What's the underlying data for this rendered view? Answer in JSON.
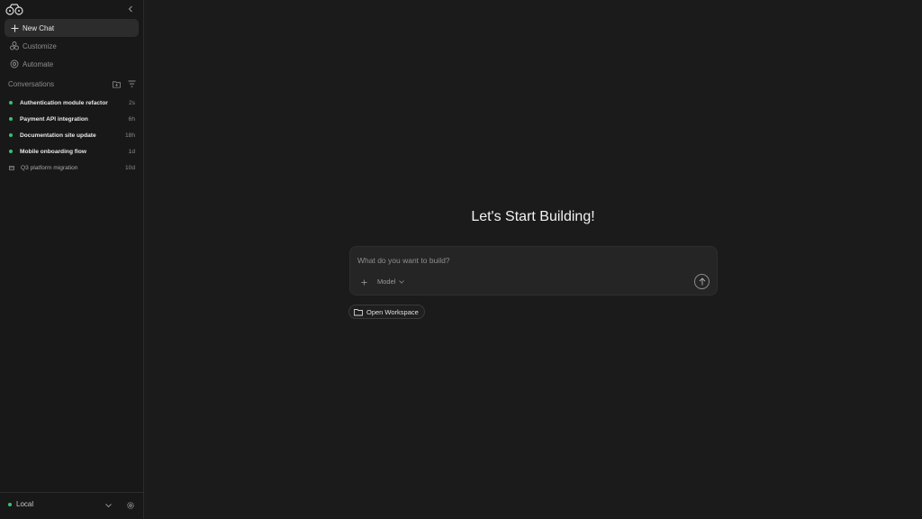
{
  "sidebar": {
    "nav": [
      {
        "label": "New Chat",
        "icon": "plus-icon",
        "active": true
      },
      {
        "label": "Customize",
        "icon": "customize-icon",
        "active": false
      },
      {
        "label": "Automate",
        "icon": "automate-icon",
        "active": false
      }
    ],
    "section_title": "Conversations",
    "conversations": [
      {
        "title": "Authentication module refactor",
        "time": "2s",
        "status": "active"
      },
      {
        "title": "Payment API integration",
        "time": "6h",
        "status": "active"
      },
      {
        "title": "Documentation site update",
        "time": "18h",
        "status": "active"
      },
      {
        "title": "Mobile onboarding flow",
        "time": "1d",
        "status": "active"
      },
      {
        "title": "Q3 platform migration",
        "time": "10d",
        "status": "archived"
      }
    ],
    "environment": "Local"
  },
  "main": {
    "heading": "Let's Start Building!",
    "composer": {
      "placeholder": "What do you want to build?",
      "model_label": "Model"
    },
    "open_workspace_label": "Open Workspace"
  },
  "colors": {
    "background": "#1b1b1b",
    "sidebar": "#181818",
    "status_green": "#38c172"
  }
}
